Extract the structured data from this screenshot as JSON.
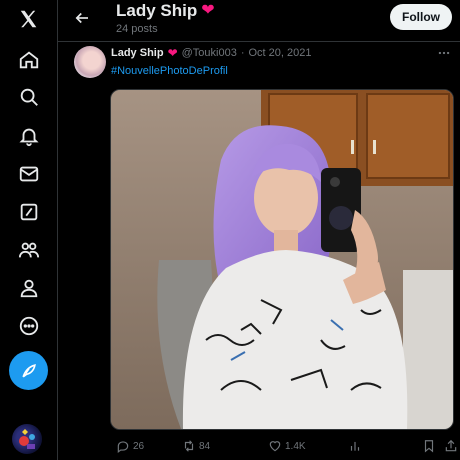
{
  "sidebar": {
    "items": [
      {
        "icon": "x-logo-icon"
      },
      {
        "icon": "home-icon"
      },
      {
        "icon": "search-icon"
      },
      {
        "icon": "notifications-icon"
      },
      {
        "icon": "messages-icon"
      },
      {
        "icon": "grok-icon"
      },
      {
        "icon": "communities-icon"
      },
      {
        "icon": "profile-icon"
      },
      {
        "icon": "more-icon"
      }
    ],
    "post_button_icon": "feather-icon"
  },
  "header": {
    "title": "Lady Ship",
    "title_emoji": "❤",
    "post_count": "24 posts",
    "follow_label": "Follow"
  },
  "tweet": {
    "author_name": "Lady Ship",
    "author_emoji": "❤",
    "handle": "@Touki003",
    "separator": "·",
    "date": "Oct 20, 2021",
    "hashtag": "#NouvellePhotoDeProfil",
    "replies": "26",
    "reposts": "84",
    "likes": "1.4K"
  },
  "colors": {
    "background": "#000000",
    "accent": "#1d9bf0",
    "heart": "#f91880",
    "muted": "#71767b",
    "text": "#e7e9ea"
  }
}
